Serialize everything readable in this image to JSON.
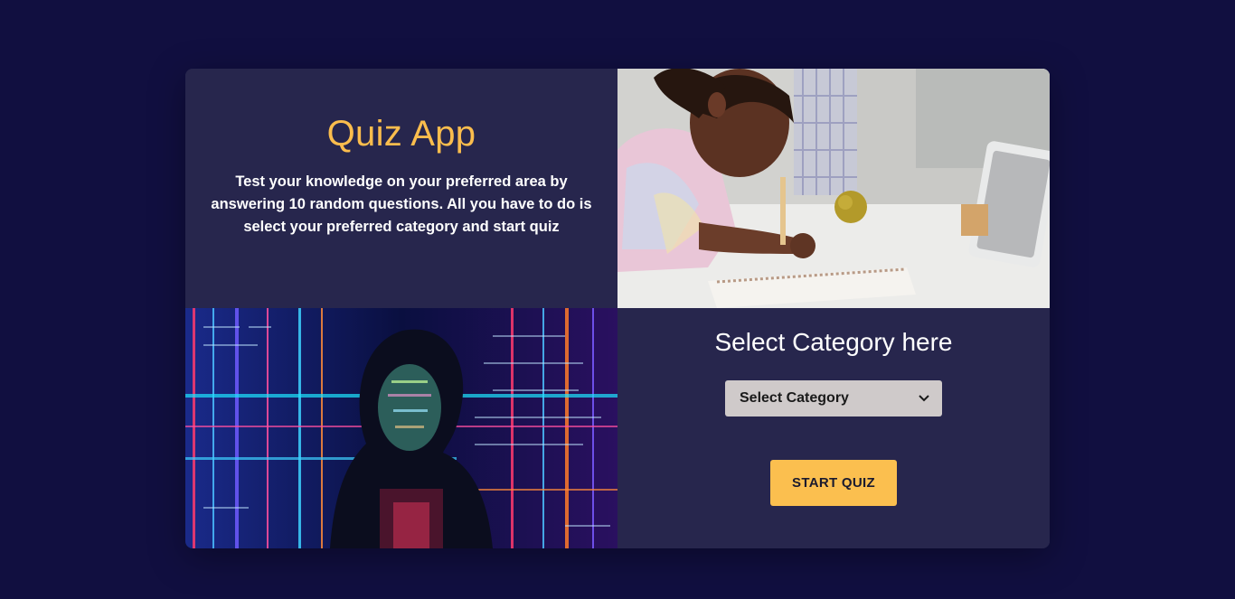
{
  "intro": {
    "title": "Quiz App",
    "description": "Test your knowledge on your preferred area by answering 10 random questions. All you have to do is select your preferred category and start quiz"
  },
  "images": {
    "study_photo": "girl-writing-in-notebook-photo",
    "code_photo": "woman-with-code-projection-photo"
  },
  "category": {
    "heading": "Select Category here",
    "select_value": "Select Category",
    "chevron_icon": "chevron-down-icon"
  },
  "actions": {
    "start_label": "START QUIZ"
  },
  "colors": {
    "page_bg": "#110f40",
    "card_bg": "#27264d",
    "accent": "#fbbf4f",
    "select_bg": "#cfcaca"
  }
}
